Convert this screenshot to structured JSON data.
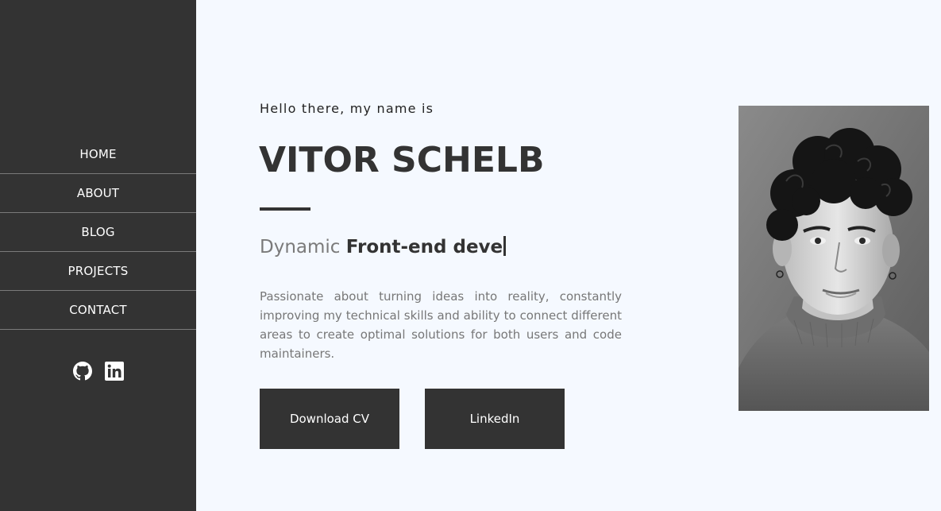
{
  "sidebar": {
    "nav": [
      {
        "label": "HOME"
      },
      {
        "label": "ABOUT"
      },
      {
        "label": "BLOG"
      },
      {
        "label": "PROJECTS"
      },
      {
        "label": "CONTACT"
      }
    ],
    "socials": [
      {
        "icon": "github-icon"
      },
      {
        "icon": "linkedin-icon"
      }
    ]
  },
  "hero": {
    "greeting": "Hello there, my name is",
    "name": "VITOR SCHELB",
    "role_prefix": "Dynamic",
    "role_typed": "Front-end deve",
    "bio": "Passionate about turning ideas into reality, constantly improving my technical skills and ability to connect different areas to create optimal solutions for both users and code maintainers.",
    "buttons": {
      "download_cv": "Download CV",
      "linkedin": "LinkedIn"
    }
  },
  "colors": {
    "sidebar_bg": "#333333",
    "page_bg": "#f5f9ff",
    "accent": "#333333",
    "muted_text": "#777777"
  }
}
